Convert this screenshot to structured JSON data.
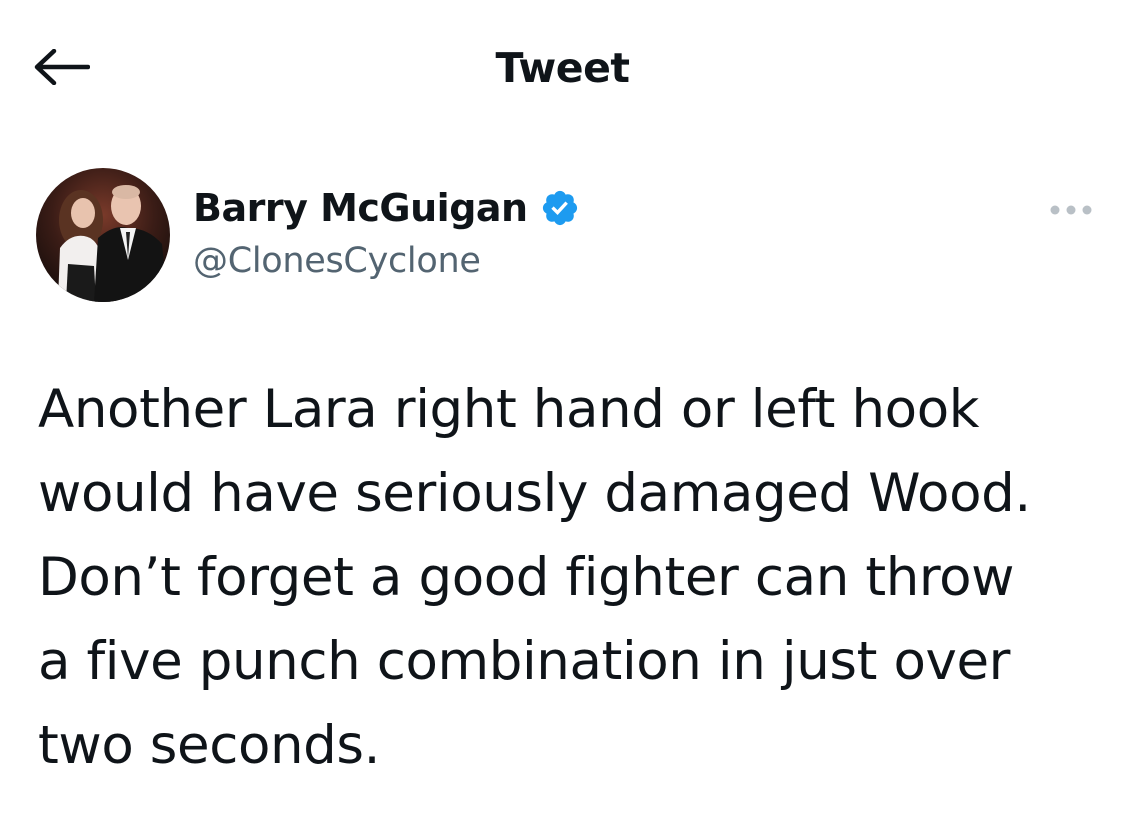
{
  "header": {
    "title": "Tweet",
    "back_icon": "arrow-left-icon"
  },
  "tweet": {
    "author": {
      "display_name": "Barry McGuigan",
      "handle": "@ClonesCyclone",
      "verified": true,
      "verified_icon": "verified-badge-icon",
      "avatar": "avatar-photo"
    },
    "more_icon": "more-options-icon",
    "text": "Another Lara right hand or left hook\nwould have seriously damaged Wood.\nDon’t forget a good fighter can throw\na five punch combination in just over\ntwo seconds."
  },
  "colors": {
    "text": "#0f1419",
    "secondary": "#536471",
    "verified": "#1d9bf0",
    "background": "#ffffff"
  }
}
